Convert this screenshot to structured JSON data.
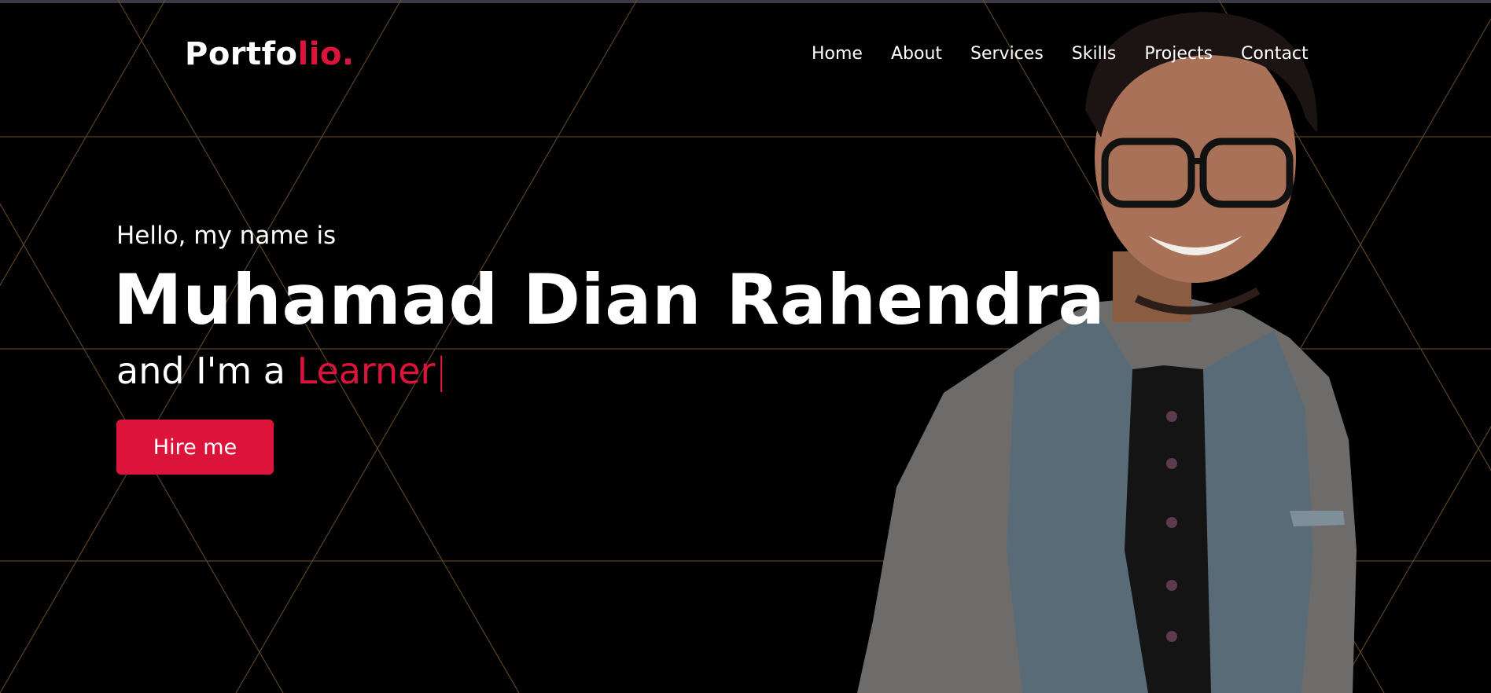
{
  "brand": {
    "logo_main": "Portfo",
    "logo_accent": "lio."
  },
  "nav": {
    "items": [
      {
        "label": "Home"
      },
      {
        "label": "About"
      },
      {
        "label": "Services"
      },
      {
        "label": "Skills"
      },
      {
        "label": "Projects"
      },
      {
        "label": "Contact"
      }
    ]
  },
  "hero": {
    "greeting": "Hello, my name is",
    "name": "Muhamad Dian Rahendra",
    "role_prefix": "and I'm a ",
    "role_typed": "Learner",
    "caret": "|",
    "cta_label": "Hire me"
  },
  "theme": {
    "background": "#000000",
    "accent": "#dc143c",
    "text": "#ffffff",
    "pattern_line": "#8a6a3a"
  },
  "icons": {
    "portrait": "person-photo"
  }
}
